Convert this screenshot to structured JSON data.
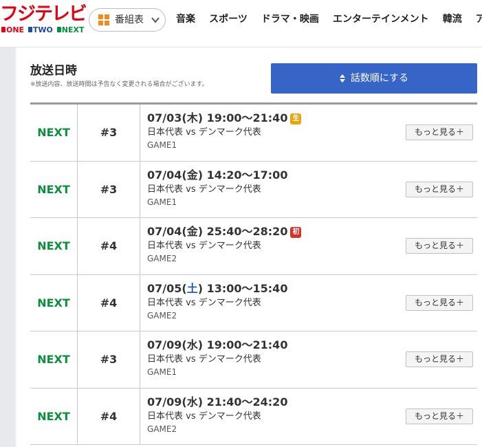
{
  "header": {
    "logo": {
      "top": "フジテレビ",
      "sub_one": "ONE",
      "sub_two": "TWO",
      "sub_next": "NEXT"
    },
    "guide_button": "番組表",
    "nav": [
      "音楽",
      "スポーツ",
      "ドラマ・映画",
      "エンターテインメント",
      "韓流",
      "アニメ"
    ]
  },
  "main": {
    "title": "放送日時",
    "note": "※放送内容、放送時間は予告なく変更される場合がございます。",
    "sort_button": "話数順にする",
    "more_label": "もっと見る＋",
    "rows": [
      {
        "channel": "NEXT",
        "episode": "#3",
        "date": "07/03(",
        "weekday": "木",
        "time": ") 19:00〜21:40",
        "badge": "生",
        "badge_type": "live",
        "title": "日本代表 vs デンマーク代表",
        "game": "GAME1"
      },
      {
        "channel": "NEXT",
        "episode": "#3",
        "date": "07/04(",
        "weekday": "金",
        "time": ") 14:20〜17:00",
        "badge": "",
        "badge_type": "",
        "title": "日本代表 vs デンマーク代表",
        "game": "GAME1"
      },
      {
        "channel": "NEXT",
        "episode": "#4",
        "date": "07/04(",
        "weekday": "金",
        "time": ") 25:40〜28:20",
        "badge": "初",
        "badge_type": "first",
        "title": "日本代表 vs デンマーク代表",
        "game": "GAME2"
      },
      {
        "channel": "NEXT",
        "episode": "#4",
        "date": "07/05(",
        "weekday": "土",
        "time": ") 13:00〜15:40",
        "badge": "",
        "badge_type": "",
        "title": "日本代表 vs デンマーク代表",
        "game": "GAME2"
      },
      {
        "channel": "NEXT",
        "episode": "#3",
        "date": "07/09(",
        "weekday": "水",
        "time": ") 19:00〜21:40",
        "badge": "",
        "badge_type": "",
        "title": "日本代表 vs デンマーク代表",
        "game": "GAME1"
      },
      {
        "channel": "NEXT",
        "episode": "#4",
        "date": "07/09(",
        "weekday": "水",
        "time": ") 21:40〜24:20",
        "badge": "",
        "badge_type": "",
        "title": "日本代表 vs デンマーク代表",
        "game": "GAME2"
      }
    ]
  },
  "colors": {
    "accent": "#3665c7",
    "next_green": "#0b8f3c",
    "live_badge": "#e6a40e",
    "first_badge": "#d2342c",
    "saturday": "#2a5ab8"
  }
}
